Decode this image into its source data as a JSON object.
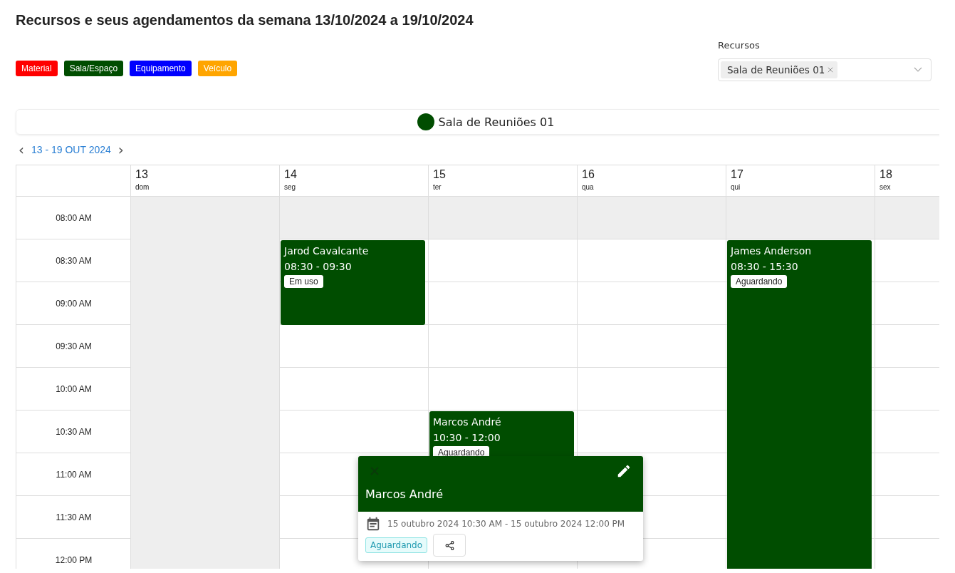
{
  "title": "Recursos e seus agendamentos da semana 13/10/2024 a 19/10/2024",
  "legend": [
    {
      "label": "Material",
      "color": "#ff0000"
    },
    {
      "label": "Sala/Espaço",
      "color": "#004d00"
    },
    {
      "label": "Equipamento",
      "color": "#0000ff"
    },
    {
      "label": "Veículo",
      "color": "#ffa500"
    }
  ],
  "resource_filter": {
    "label": "Recursos",
    "chips": [
      "Sala de Reuniões 01"
    ]
  },
  "resource_bar": {
    "name": "Sala de Reuniões 01",
    "color": "#004d00"
  },
  "week_nav": {
    "prev": "‹",
    "range": "13 - 19 OUT 2024",
    "next": "›"
  },
  "slots": [
    {
      "time": "08:00 AM",
      "disabled": true
    },
    {
      "time": "08:30 AM",
      "disabled": false
    },
    {
      "time": "09:00 AM",
      "disabled": false
    },
    {
      "time": "09:30 AM",
      "disabled": false
    },
    {
      "time": "10:00 AM",
      "disabled": false
    },
    {
      "time": "10:30 AM",
      "disabled": false
    },
    {
      "time": "11:00 AM",
      "disabled": false
    },
    {
      "time": "11:30 AM",
      "disabled": false
    },
    {
      "time": "12:00 PM",
      "disabled": false
    }
  ],
  "days": [
    {
      "date": "13",
      "weekday": "dom",
      "disabled": true
    },
    {
      "date": "14",
      "weekday": "seg",
      "disabled": false,
      "events": [
        {
          "title": "Jarod Cavalcante",
          "time": "08:30 - 09:30",
          "status": "Em uso",
          "color": "#004d00"
        }
      ]
    },
    {
      "date": "15",
      "weekday": "ter",
      "disabled": false,
      "events": [
        {
          "title": "Marcos André",
          "time": "10:30 - 12:00",
          "status": "Aguardando",
          "color": "#004d00"
        }
      ]
    },
    {
      "date": "16",
      "weekday": "qua",
      "disabled": false
    },
    {
      "date": "17",
      "weekday": "qui",
      "disabled": false,
      "events": [
        {
          "title": "James Anderson",
          "time": "08:30 - 15:30",
          "status": "Aguardando",
          "color": "#004d00"
        }
      ]
    },
    {
      "date": "18",
      "weekday": "sex",
      "disabled": false
    }
  ],
  "popup": {
    "title": "Marcos André",
    "color": "#004d00",
    "datetime": "15 outubro 2024 10:30 AM - 15 outubro 2024 12:00 PM",
    "status": "Aguardando"
  }
}
